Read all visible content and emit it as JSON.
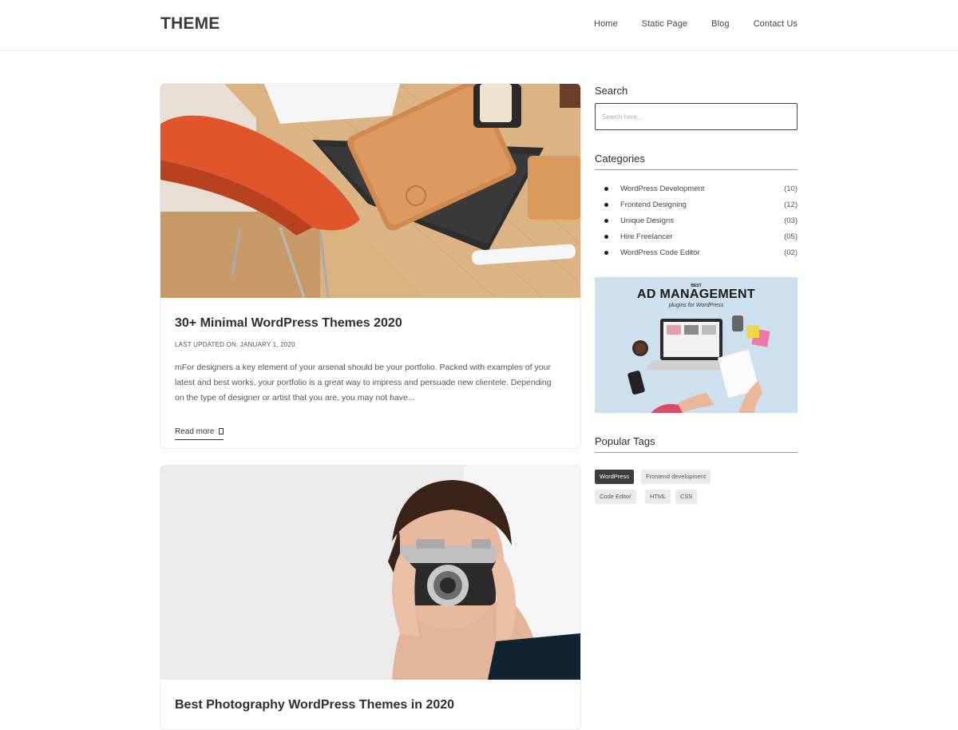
{
  "header": {
    "brand": "THEME",
    "nav": [
      "Home",
      "Static Page",
      "Blog",
      "Contact Us"
    ]
  },
  "posts": [
    {
      "title": "30+ Minimal WordPress Themes 2020",
      "meta": "LAST UPDATED ON: JANUARY 1, 2020",
      "excerpt": "mFor designers a key element of your arsenal should be your portfolio. Packed with examples of your latest and best works, your portfolio is a great way to impress and persuade new clientele. Depending on the type of designer or artist that you are, you may not have...",
      "read_more": "Read more",
      "image_icon": "desk-workspace-photo"
    },
    {
      "title": "Best Photography WordPress Themes in 2020",
      "image_icon": "woman-with-camera-photo"
    }
  ],
  "sidebar": {
    "search": {
      "title": "Search",
      "placeholder": "Search here..."
    },
    "categories": {
      "title": "Categories",
      "items": [
        {
          "name": "WordPress Development",
          "count": "(10)"
        },
        {
          "name": "Frontend Designing",
          "count": "(12)"
        },
        {
          "name": "Unique Designs",
          "count": "(03)"
        },
        {
          "name": "Hire Freelancer",
          "count": "(05)"
        },
        {
          "name": "WordPress Code Editor",
          "count": "(02)"
        }
      ]
    },
    "ad": {
      "best": "BEST",
      "title": "AD MANAGEMENT",
      "subtitle": "plugins for WordPress"
    },
    "tags": {
      "title": "Popular Tags",
      "items": [
        "WordPress",
        "Frontend development",
        "Code Editor",
        "HTML",
        "CSS"
      ]
    }
  }
}
